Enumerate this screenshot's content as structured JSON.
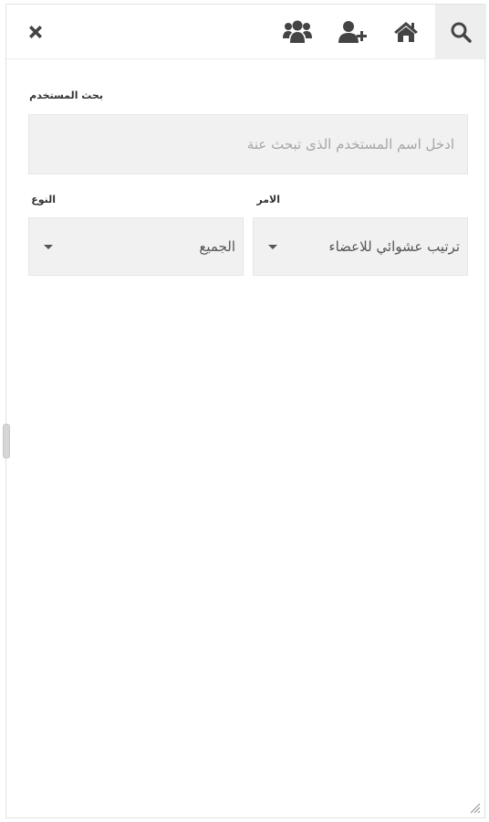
{
  "toolbar": {
    "close_icon": "close-icon",
    "groups_icon": "users-group-icon",
    "add_user_icon": "user-plus-icon",
    "home_icon": "home-icon",
    "search_icon": "search-icon"
  },
  "search": {
    "label": "بحث المستخدم",
    "placeholder": "ادخل اسم المستخدم الذى تبحث عنة",
    "value": ""
  },
  "filters": {
    "order": {
      "label": "الامر",
      "selected": "ترتيب عشوائي للاعضاء"
    },
    "type": {
      "label": "النوع",
      "selected": "الجميع"
    }
  },
  "colors": {
    "toolbar_active_bg": "#eeeeee",
    "field_bg": "#f1f1f1",
    "icon": "#444444"
  }
}
